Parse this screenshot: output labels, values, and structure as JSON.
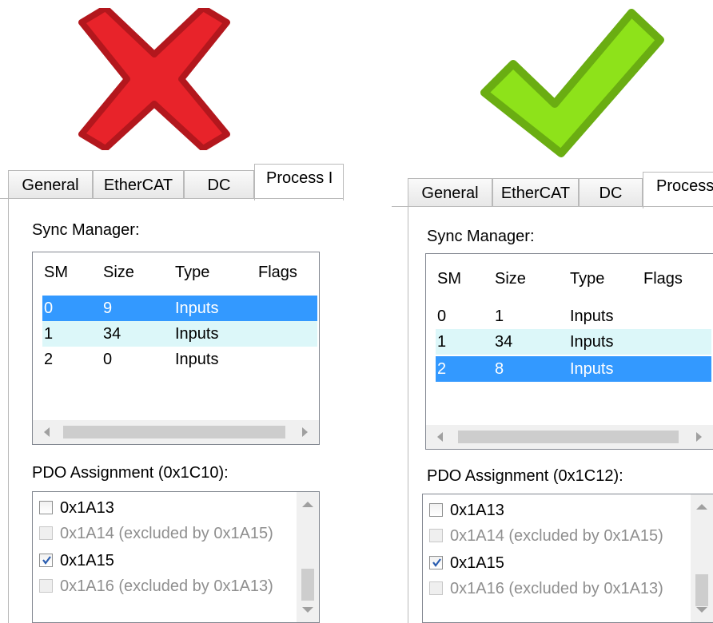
{
  "left": {
    "tabs": [
      "General",
      "EtherCAT",
      "DC",
      "Process I"
    ],
    "sync_manager_label": "Sync Manager:",
    "columns": [
      "SM",
      "Size",
      "Type",
      "Flags"
    ],
    "rows": [
      {
        "sm": "0",
        "size": "9",
        "type": "Inputs"
      },
      {
        "sm": "1",
        "size": "34",
        "type": "Inputs"
      },
      {
        "sm": "2",
        "size": "0",
        "type": "Inputs"
      }
    ],
    "pdo_label": "PDO Assignment (0x1C10):",
    "pdo_items": [
      {
        "label": "0x1A13",
        "checked": false,
        "disabled": false
      },
      {
        "label": "0x1A14 (excluded by 0x1A15)",
        "checked": false,
        "disabled": true
      },
      {
        "label": "0x1A15",
        "checked": true,
        "disabled": false
      },
      {
        "label": "0x1A16 (excluded by 0x1A13)",
        "checked": false,
        "disabled": true
      }
    ]
  },
  "right": {
    "tabs": [
      "General",
      "EtherCAT",
      "DC",
      "Process"
    ],
    "sync_manager_label": "Sync Manager:",
    "columns": [
      "SM",
      "Size",
      "Type",
      "Flags"
    ],
    "rows": [
      {
        "sm": "0",
        "size": "1",
        "type": "Inputs"
      },
      {
        "sm": "1",
        "size": "34",
        "type": "Inputs"
      },
      {
        "sm": "2",
        "size": "8",
        "type": "Inputs"
      }
    ],
    "pdo_label": "PDO Assignment (0x1C12):",
    "pdo_items": [
      {
        "label": "0x1A13",
        "checked": false,
        "disabled": false
      },
      {
        "label": "0x1A14 (excluded by 0x1A15)",
        "checked": false,
        "disabled": true
      },
      {
        "label": "0x1A15",
        "checked": true,
        "disabled": false
      },
      {
        "label": "0x1A16 (excluded by 0x1A13)",
        "checked": false,
        "disabled": true
      }
    ]
  },
  "icons": {
    "wrong": "red-cross-icon",
    "right": "green-checkmark-icon"
  },
  "colors": {
    "cross": "#e8232a",
    "check": "#8ee21a",
    "selection": "#3399ff",
    "alt_row": "#dcf7f9"
  }
}
